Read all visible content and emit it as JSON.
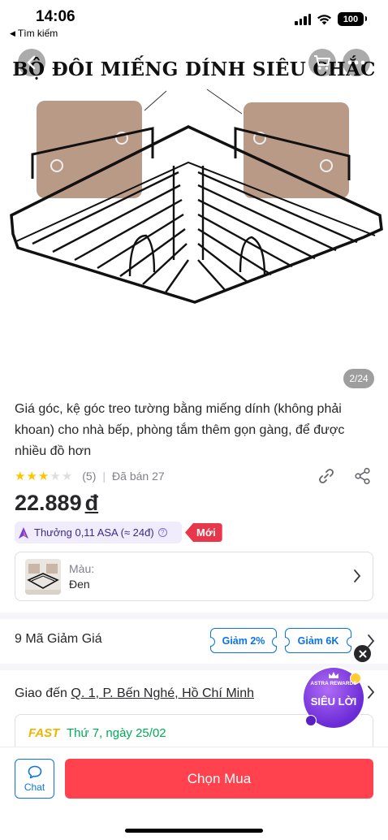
{
  "status_bar": {
    "time": "14:06",
    "back_label": "Tìm kiếm",
    "battery": "100"
  },
  "hero": {
    "banner_text": "BỘ ĐÔI MIẾNG DÍNH SIÊU CHẮC",
    "image_counter": "2/24"
  },
  "product": {
    "name": "Giá góc, kệ góc treo tường bằng miếng dính (không phải khoan) cho nhà bếp, phòng tắm thêm gọn gàng, để được nhiều đồ hơn",
    "rating": 3,
    "rating_max": 5,
    "review_count": "(5)",
    "sold": "Đã bán 27",
    "price": "22.889",
    "currency": "đ",
    "reward_text": "Thưởng 0,11 ASA (≈ 24đ)",
    "new_tag": "Mới"
  },
  "variant": {
    "label": "Màu:",
    "value": "Đen"
  },
  "coupons": {
    "title": "9 Mã Giảm Giá",
    "chips": [
      "Giảm 2%",
      "Giảm 6K"
    ]
  },
  "shipping": {
    "prefix": "Giao đến",
    "address": "Q. 1, P. Bến Nghé, Hồ Chí Minh",
    "fast_label": "FAST",
    "date": "Thứ 7, ngày 25/02"
  },
  "astra_badge": {
    "top_text": "ASTRA REWARDS",
    "main_text": "SIÊU LỜI"
  },
  "bottom": {
    "chat_label": "Chat",
    "buy_label": "Chọn Mua"
  },
  "colors": {
    "buy": "#ff424e",
    "link": "#0b74e5",
    "star": "#ffc400",
    "new_tag": "#e8374a",
    "fast": "#f0b400",
    "ship_date": "#00ab56"
  },
  "icons": [
    "back-arrow-icon",
    "cart-icon",
    "more-icon",
    "link-icon",
    "share-icon",
    "chevron-right-icon",
    "close-icon",
    "chat-icon",
    "astra-icon",
    "question-icon"
  ]
}
